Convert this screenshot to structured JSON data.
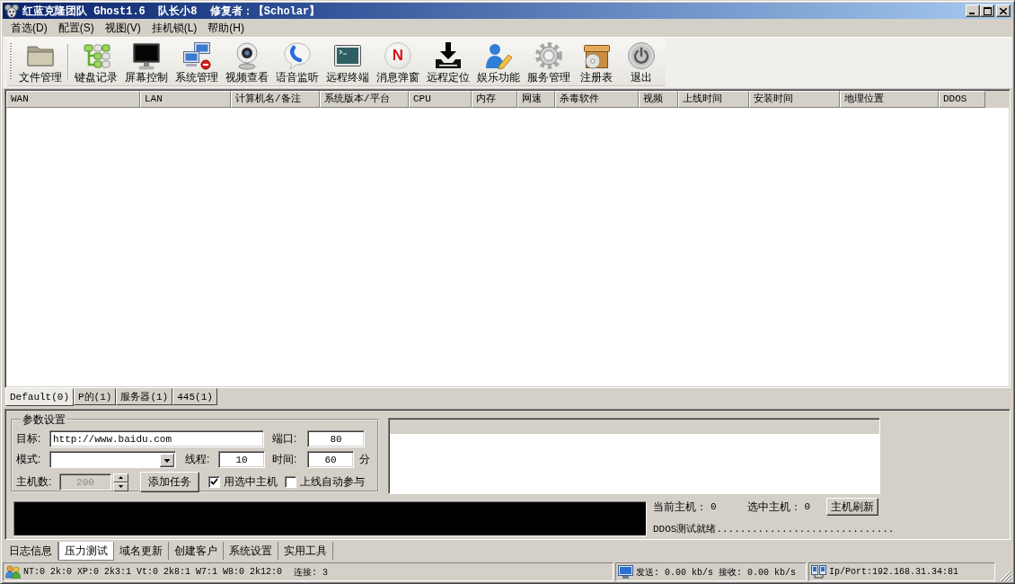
{
  "window": {
    "title": "红蓝克隆团队 Ghost1.6  队长小8  修复者：【Scholar】"
  },
  "menu": [
    "首选(D)",
    "配置(S)",
    "视图(V)",
    "挂机锁(L)",
    "帮助(H)"
  ],
  "toolbar": {
    "groups": [
      [
        {
          "label": "文件管理"
        }
      ],
      [
        {
          "label": "键盘记录"
        },
        {
          "label": "屏幕控制"
        },
        {
          "label": "系统管理"
        },
        {
          "label": "视频查看"
        },
        {
          "label": "语音监听"
        },
        {
          "label": "远程终端"
        },
        {
          "label": "消息弹窗",
          "logo_text": "N"
        },
        {
          "label": "远程定位"
        },
        {
          "label": "娱乐功能"
        },
        {
          "label": "服务管理"
        },
        {
          "label": "注册表"
        },
        {
          "label": "退出"
        }
      ]
    ]
  },
  "table": {
    "columns": [
      "WAN",
      "LAN",
      "计算机名/备注",
      "系统版本/平台",
      "CPU",
      "内存",
      "网速",
      "杀毒软件",
      "视频",
      "上线时间",
      "安装时间",
      "地理位置",
      "DDOS"
    ]
  },
  "group_tabs": [
    {
      "label": "Default(0)",
      "selected": true
    },
    {
      "label": "P的(1)",
      "selected": false
    },
    {
      "label": "服务器(1)",
      "selected": false
    },
    {
      "label": "445(1)",
      "selected": false
    }
  ],
  "params": {
    "title": "参数设置",
    "target": {
      "label": "目标:",
      "value": "http://www.baidu.com"
    },
    "port": {
      "label": "端口:",
      "value": "80"
    },
    "mode": {
      "label": "模式:"
    },
    "threads": {
      "label": "线程:",
      "value": "10"
    },
    "duration": {
      "label": "时间:",
      "value": "60",
      "unit": "分"
    },
    "host_count": {
      "label": "主机数:",
      "value": "200",
      "disabled": true
    },
    "add_task_button": "添加任务",
    "options": [
      {
        "label": "用选中主机",
        "checked": true
      },
      {
        "label": "上线自动参与",
        "checked": false
      }
    ]
  },
  "hosts": {
    "current": {
      "label": "当前主机：",
      "value": "0"
    },
    "selected": {
      "label": "选中主机：",
      "value": "0"
    },
    "refresh_button": "主机刷新",
    "status": "DDOS测试就绪.............................."
  },
  "bottom_tabs": [
    {
      "label": "日志信息",
      "selected": false
    },
    {
      "label": "压力测试",
      "selected": true
    },
    {
      "label": "域名更新",
      "selected": false
    },
    {
      "label": "创建客户",
      "selected": false
    },
    {
      "label": "系统设置",
      "selected": false
    },
    {
      "label": "实用工具",
      "selected": false
    }
  ],
  "status_bar": {
    "os_counts": "NT:0 2k:0 XP:0 2k3:1 Vt:0 2k8:1 W7:1 W8:0 2k12:0",
    "connections": "连接: 3",
    "traffic": "发送: 0.00 kb/s 接收: 0.00 kb/s",
    "address": "Ip/Port:192.168.31.34:81"
  }
}
